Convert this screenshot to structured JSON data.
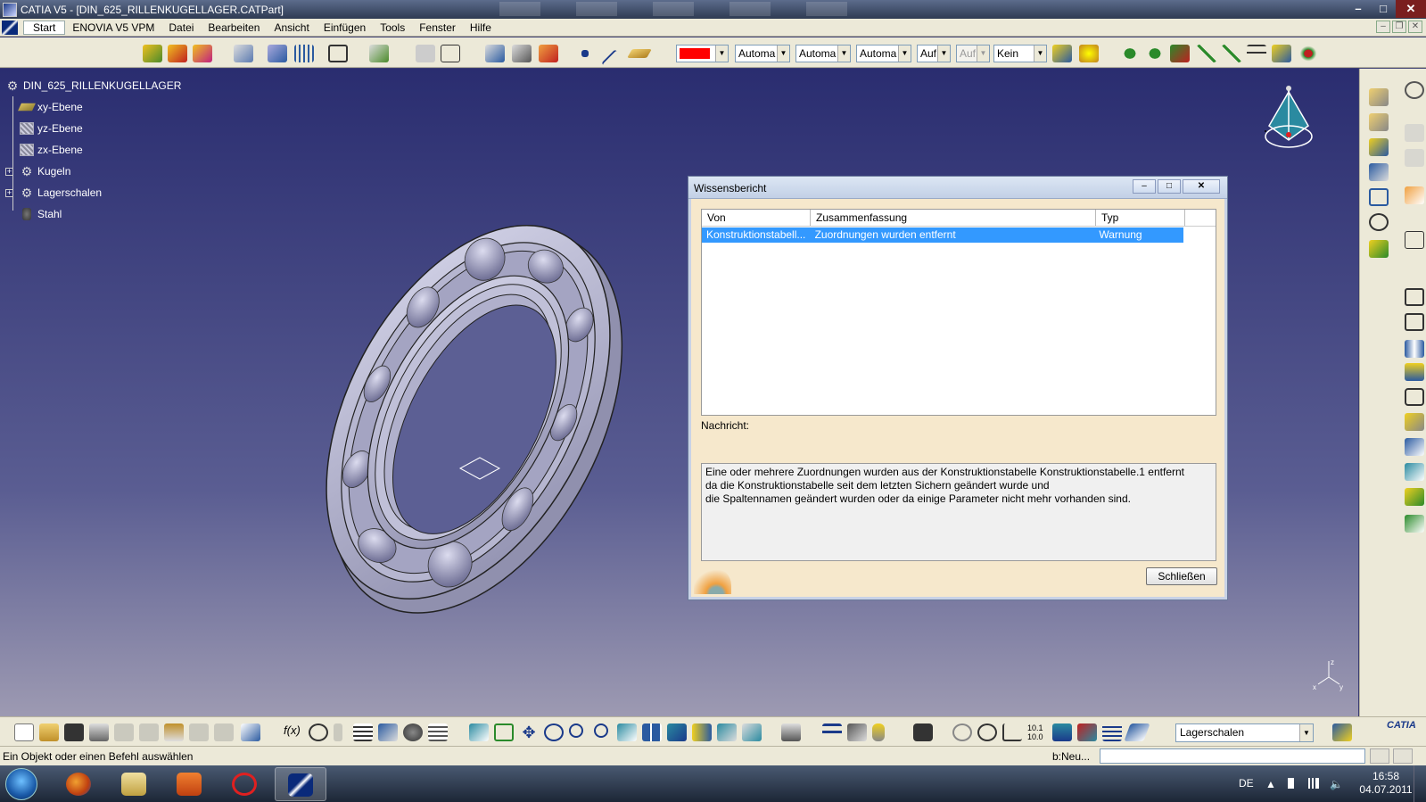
{
  "window": {
    "title": "CATIA V5 - [DIN_625_RILLENKUGELLAGER.CATPart]",
    "buttons": [
      "–",
      "□",
      "✕"
    ]
  },
  "menu": {
    "items": [
      {
        "label": "Start",
        "accel": "S"
      },
      {
        "label": "ENOVIA V5 VPM"
      },
      {
        "label": "Datei",
        "accel": "D"
      },
      {
        "label": "Bearbeiten",
        "accel": "B"
      },
      {
        "label": "Ansicht",
        "accel": "A"
      },
      {
        "label": "Einfügen",
        "accel": "E"
      },
      {
        "label": "Tools",
        "accel": "T"
      },
      {
        "label": "Fenster",
        "accel": "F"
      },
      {
        "label": "Hilfe",
        "accel": "H"
      }
    ]
  },
  "toolbar_top": {
    "color_value": "#ff0000",
    "combos": [
      "Automa",
      "Automa",
      "Automa",
      "Auf",
      "Auf",
      "Kein"
    ]
  },
  "tree": {
    "root": "DIN_625_RILLENKUGELLAGER",
    "items": [
      {
        "label": "xy-Ebene",
        "icon": "plane-icon"
      },
      {
        "label": "yz-Ebene",
        "icon": "plane-icon"
      },
      {
        "label": "zx-Ebene",
        "icon": "plane-icon"
      },
      {
        "label": "Kugeln",
        "icon": "body-icon",
        "expandable": true
      },
      {
        "label": "Lagerschalen",
        "icon": "body-icon",
        "expandable": true
      },
      {
        "label": "Stahl",
        "icon": "material-icon"
      }
    ]
  },
  "dialog": {
    "title": "Wissensbericht",
    "columns": [
      "Von",
      "Zusammenfassung",
      "Typ"
    ],
    "rows": [
      {
        "von": "Konstruktionstabell...",
        "zusammenfassung": "Zuordnungen wurden entfernt",
        "typ": "Warnung"
      }
    ],
    "message_label": "Nachricht:",
    "message_lines": [
      "Eine oder mehrere Zuordnungen wurden aus der Konstruktionstabelle Konstruktionstabelle.1 entfernt",
      "da die Konstruktionstabelle seit dem letzten Sichern geändert wurde und",
      "die Spaltennamen geändert wurden oder da einige Parameter nicht mehr vorhanden sind."
    ],
    "close_label": "Schließen"
  },
  "toolbar_bottom": {
    "current_body": "Lagerschalen"
  },
  "status": {
    "prompt": "Ein Objekt oder einen Befehl auswählen",
    "command_label": "b:Neu..."
  },
  "taskbar": {
    "language": "DE",
    "time": "16:58",
    "date": "04.07.2011"
  },
  "axis": {
    "x": "x",
    "y": "y",
    "z": "z"
  },
  "brand": "CATIA"
}
